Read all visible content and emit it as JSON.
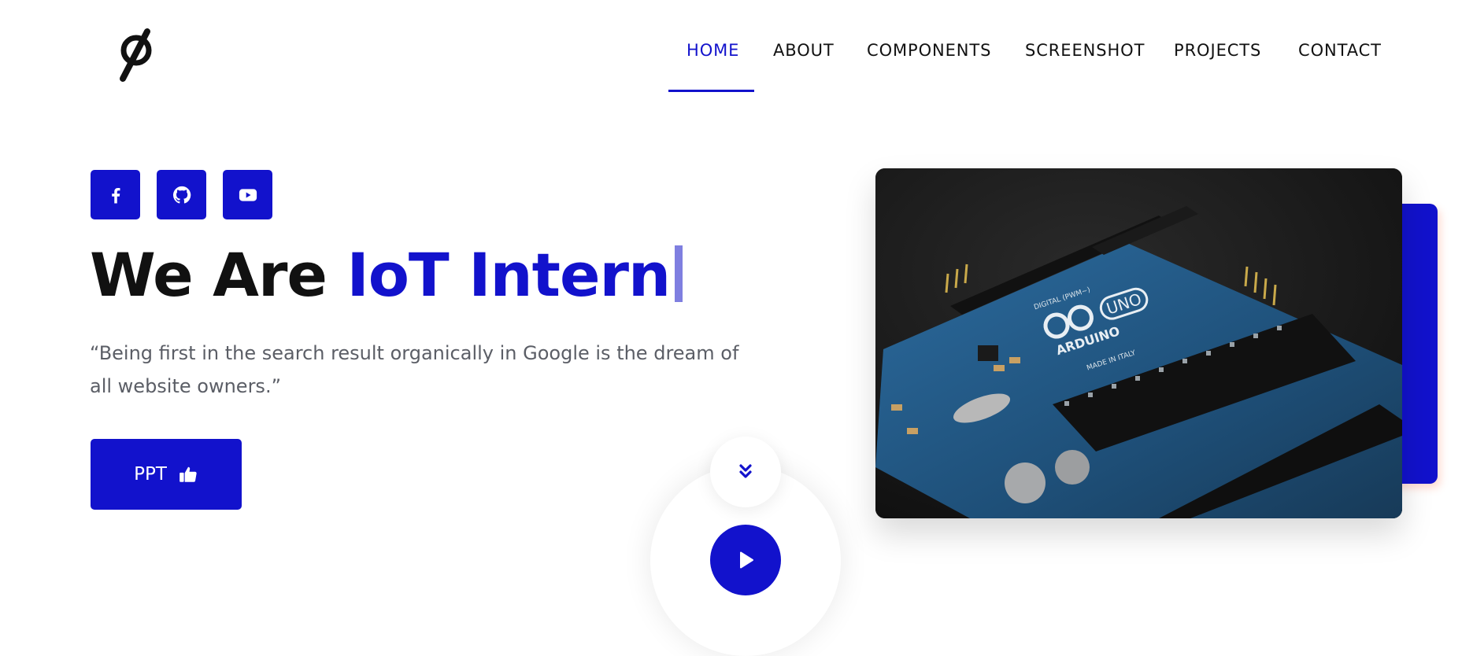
{
  "nav": {
    "items": [
      {
        "label": "HOME",
        "active": true
      },
      {
        "label": "ABOUT",
        "active": false
      },
      {
        "label": "COMPONENTS",
        "active": false
      },
      {
        "label": "SCREENSHOT",
        "active": false
      },
      {
        "label": "PROJECTS",
        "active": false
      },
      {
        "label": "CONTACT",
        "active": false
      }
    ]
  },
  "social": [
    "facebook-icon",
    "github-icon",
    "youtube-icon"
  ],
  "hero": {
    "headline_black": "We Are ",
    "headline_blue": "IoT Intern",
    "quote": "“Being first in the search result organically in Google is the dream of all website owners.”",
    "button_label": "PPT"
  },
  "photo": {
    "board_brand": "ARDUINO",
    "board_model": "UNO",
    "board_text": "MADE IN ITALY",
    "board_digital": "DIGITAL (PWM~)"
  },
  "colors": {
    "accent": "#1212cc",
    "text": "#111111",
    "muted": "#5b5e66"
  }
}
